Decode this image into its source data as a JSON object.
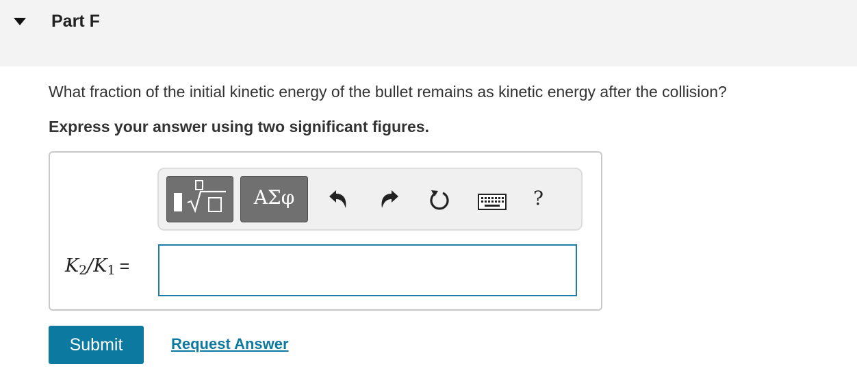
{
  "part": {
    "title": "Part F",
    "collapse_icon": "caret-down-icon"
  },
  "question": {
    "text": "What fraction of the initial kinetic energy of the bullet remains as kinetic energy after the collision?",
    "instruction": "Express your answer using two significant figures."
  },
  "toolbar": {
    "templates_icon": "templates-sqrt-icon",
    "greek_label": "ΑΣφ",
    "undo_icon": "undo-icon",
    "redo_icon": "redo-icon",
    "reset_icon": "reset-icon",
    "keyboard_icon": "keyboard-icon",
    "help_label": "?"
  },
  "answer": {
    "lhs_k2": "K",
    "lhs_k2_sub": "2",
    "lhs_slash": "/",
    "lhs_k1": "K",
    "lhs_k1_sub": "1",
    "lhs_eq": "=",
    "value": ""
  },
  "actions": {
    "submit_label": "Submit",
    "request_label": "Request Answer"
  },
  "colors": {
    "accent": "#0c7aa0",
    "input_border": "#1b7ea6",
    "header_bg": "#f3f3f3"
  }
}
